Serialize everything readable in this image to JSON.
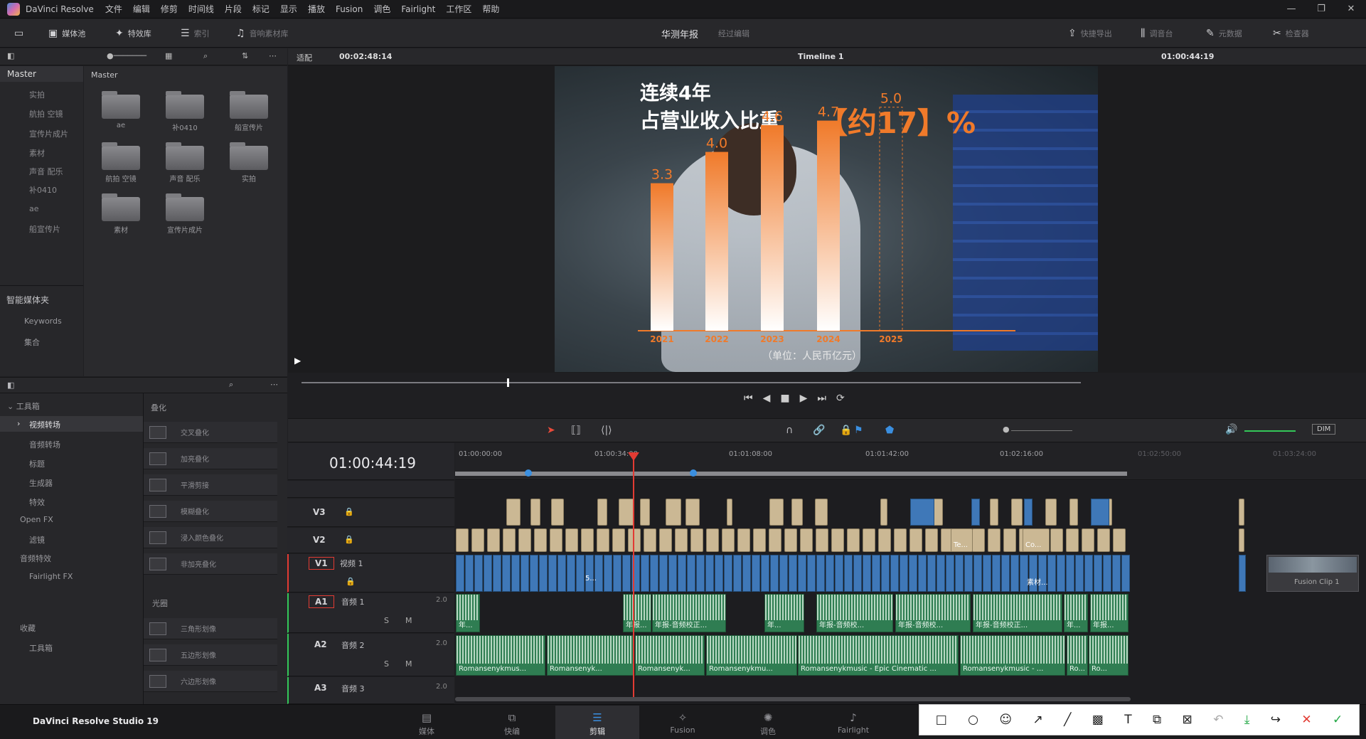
{
  "app": {
    "title": "DaVinci Resolve",
    "studio_label": "DaVinci Resolve Studio 19"
  },
  "menu": [
    "文件",
    "编辑",
    "修剪",
    "时间线",
    "片段",
    "标记",
    "显示",
    "播放",
    "Fusion",
    "调色",
    "Fairlight",
    "工作区",
    "帮助"
  ],
  "toolbar": {
    "media_pool": "媒体池",
    "effects": "特效库",
    "index": "索引",
    "sound_library": "音响素材库",
    "project_name": "华测年报",
    "project_status": "经过编辑",
    "quick_export": "快捷导出",
    "mixer": "调音台",
    "metadata": "元数据",
    "inspector": "检查器"
  },
  "viewer_bar": {
    "fit": "适配",
    "source_tc": "00:02:48:14",
    "timeline_name": "Timeline 1",
    "record_tc": "01:00:44:19"
  },
  "media_pool": {
    "master": "Master",
    "bins": [
      "实拍",
      "航拍 空镜",
      "宣传片成片",
      "素材",
      "声音 配乐",
      "补0410",
      "ae",
      "船宣传片"
    ],
    "folders": [
      "ae",
      "补0410",
      "船宣传片",
      "航拍 空镜",
      "声音 配乐",
      "实拍",
      "素材",
      "宣传片成片"
    ],
    "smart_bins_title": "智能媒体夹",
    "smart_bins": [
      "Keywords",
      "集合"
    ]
  },
  "effects_panel": {
    "toolbox": "工具箱",
    "items": [
      "视频转场",
      "音频转场",
      "标题",
      "生成器",
      "特效"
    ],
    "open_fx": "Open FX",
    "open_fx_items": [
      "滤镜"
    ],
    "audio_fx": "音频特效",
    "audio_fx_items": [
      "Fairlight FX"
    ],
    "favorites": "收藏",
    "favorites_items": [
      "工具箱"
    ],
    "dissolve_header": "叠化",
    "dissolves": [
      "交叉叠化",
      "加亮叠化",
      "平滑剪接",
      "模糊叠化",
      "浸入颜色叠化",
      "非加亮叠化"
    ],
    "iris_header": "光圈",
    "iris": [
      "三角形划像",
      "五边形划像",
      "六边形划像"
    ]
  },
  "frame": {
    "line1": "连续4年",
    "line2": "占营业收入比重",
    "highlight": "【约17】%",
    "unit": "（单位：人民币亿元）"
  },
  "chart_data": {
    "type": "bar",
    "categories": [
      "2021",
      "2022",
      "2023",
      "2024",
      "2025"
    ],
    "values": [
      3.3,
      4.0,
      4.6,
      4.7,
      5.0
    ],
    "value_labels": [
      "3.3",
      "4.0",
      "4.6",
      "4.7",
      "5.0"
    ],
    "last_bar_style": "dashed-outline",
    "ylim": [
      0,
      5.6
    ],
    "title": "",
    "xlabel": "",
    "ylabel": ""
  },
  "timeline": {
    "timecode": "01:00:44:19",
    "ruler": [
      "01:00:00:00",
      "01:00:34:00",
      "01:01:08:00",
      "01:01:42:00",
      "01:02:16:00",
      "01:02:50:00",
      "01:03:24:00"
    ],
    "tracks": {
      "v3": "V3",
      "v2": "V2",
      "v1": "V1",
      "v1_name": "视频 1",
      "a1": "A1",
      "a1_name": "音频 1",
      "a1_level": "2.0",
      "a2": "A2",
      "a2_name": "音频 2",
      "a2_level": "2.0",
      "a3": "A3",
      "a3_name": "音频 3",
      "a3_level": "2.0"
    },
    "dim": "DIM",
    "fusion_clip": "Fusion Clip 1",
    "clip_te": "Te...",
    "clip_co": "Co...",
    "clip_5": "5...",
    "clip_sucai": "素材...",
    "a1_clips": [
      "年...",
      "年报...",
      "年报-音频校正...",
      "年...",
      "年报-音频校...",
      "年报-音频校...",
      "年报-音频校正...",
      "年...",
      "年报..."
    ],
    "a2_clips": [
      "Romansenykmus...",
      "Romansenyk...",
      "Romansenyk...",
      "Romansenykmu...",
      "Romansenykmusic - Epic Cinematic ...",
      "Romansenykmusic - ...",
      "Ro...",
      "Ro..."
    ]
  },
  "pages": [
    "媒体",
    "快编",
    "剪辑",
    "Fusion",
    "调色",
    "Fairlight"
  ],
  "colors": {
    "accent_orange": "#f07a2a",
    "playhead": "#e23b33",
    "video_clip": "#3f78b8",
    "audio_clip": "#2f7d52"
  }
}
